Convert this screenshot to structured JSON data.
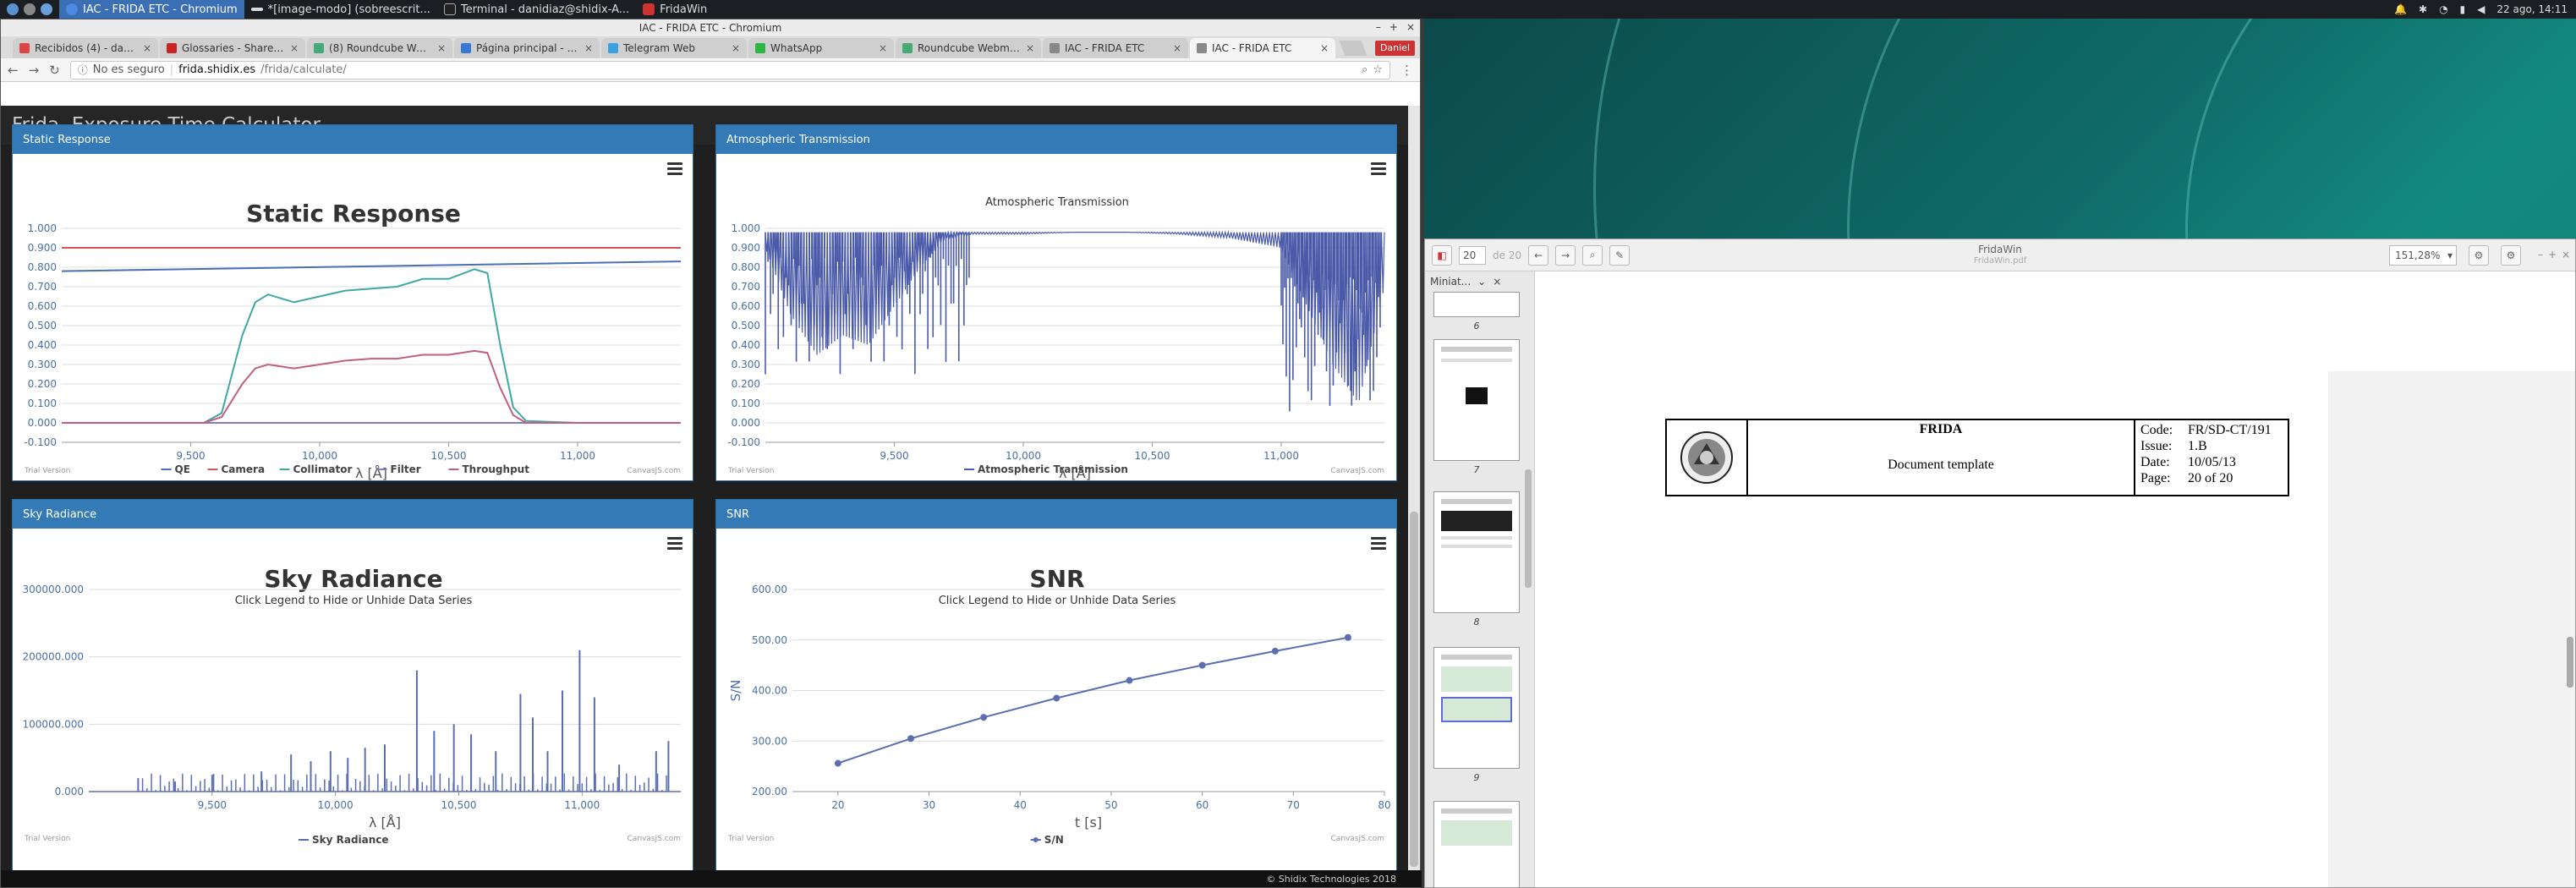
{
  "taskbar": {
    "items": [
      {
        "label": "IAC - FRIDA ETC - Chromium",
        "active": true
      },
      {
        "label": "*[image-modo] (sobreescrit...",
        "active": false
      },
      {
        "label": "Terminal - danidiaz@shidix-A...",
        "active": false
      },
      {
        "label": "FridaWin",
        "active": false
      }
    ],
    "clock": "22 ago, 14:11"
  },
  "browser": {
    "window_title": "IAC - FRIDA ETC - Chromium",
    "tabs": [
      {
        "label": "Recibidos (4) - danidi..."
      },
      {
        "label": "Glossaries - Shared..."
      },
      {
        "label": "(8) Roundcube Web..."
      },
      {
        "label": "Página principal - D..."
      },
      {
        "label": "Telegram Web"
      },
      {
        "label": "WhatsApp"
      },
      {
        "label": "Roundcube Webmail..."
      },
      {
        "label": "IAC - FRIDA ETC"
      },
      {
        "label": "IAC - FRIDA ETC"
      }
    ],
    "active_tab_index": 8,
    "user_chip": "Daniel",
    "security": "No es seguro",
    "url_host": "frida.shidix.es",
    "url_path": "/frida/calculate/"
  },
  "page": {
    "header": "Frida. Exposure Time Calculator",
    "footer": "© Shidix Technologies 2018",
    "trial_text": "Trial Version",
    "watermark": "CanvasJS.com"
  },
  "panels": {
    "static": {
      "head": "Static Response",
      "title": "Static Response",
      "xlabel": "λ [Å]"
    },
    "atmos": {
      "head": "Atmospheric Transmission",
      "title": "Atmospheric Transmission",
      "xlabel": "λ [Å]"
    },
    "sky": {
      "head": "Sky Radiance",
      "title": "Sky Radiance",
      "subtitle": "Click Legend to Hide or Unhide Data Series",
      "xlabel": "λ [Å]"
    },
    "snr": {
      "head": "SNR",
      "title": "SNR",
      "subtitle": "Click Legend to Hide or Unhide Data Series",
      "xlabel": "t [s]",
      "ylabel": "S/N"
    }
  },
  "chart_data": [
    {
      "type": "line",
      "title": "Static Response",
      "xlabel": "λ [Å]",
      "ylabel": "",
      "xlim": [
        9000,
        11400
      ],
      "ylim": [
        -0.1,
        1.0
      ],
      "x_ticks": [
        "9,500",
        "10,000",
        "10,500",
        "11,000"
      ],
      "y_ticks": [
        "-0.100",
        "0.000",
        "0.100",
        "0.200",
        "0.300",
        "0.400",
        "0.500",
        "0.600",
        "0.700",
        "0.800",
        "0.900",
        "1.000"
      ],
      "series": [
        {
          "name": "QE",
          "color": "#4a6fb5",
          "x": [
            9000,
            11400
          ],
          "values": [
            0.78,
            0.83
          ]
        },
        {
          "name": "Camera",
          "color": "#cf5656",
          "x": [
            9000,
            11400
          ],
          "values": [
            0.9,
            0.9
          ]
        },
        {
          "name": "Collimator",
          "color": "#3fa8a0",
          "x": [
            9000,
            9550,
            9620,
            9700,
            9750,
            9800,
            9900,
            10000,
            10100,
            10300,
            10400,
            10500,
            10600,
            10650,
            10700,
            10750,
            10800,
            11000,
            11400
          ],
          "values": [
            0.0,
            0.0,
            0.05,
            0.45,
            0.62,
            0.66,
            0.62,
            0.65,
            0.68,
            0.7,
            0.74,
            0.74,
            0.79,
            0.77,
            0.4,
            0.08,
            0.01,
            0.0,
            0.0
          ]
        },
        {
          "name": "Filter",
          "color": "#8c7ab8",
          "x": [
            9000,
            11400
          ],
          "values": [
            0.0,
            0.0
          ]
        },
        {
          "name": "Throughput",
          "color": "#c06080",
          "x": [
            9000,
            9550,
            9620,
            9700,
            9750,
            9800,
            9900,
            10000,
            10100,
            10200,
            10300,
            10400,
            10500,
            10600,
            10650,
            10700,
            10750,
            10800,
            11000,
            11400
          ],
          "values": [
            0.0,
            0.0,
            0.03,
            0.2,
            0.28,
            0.3,
            0.28,
            0.3,
            0.32,
            0.33,
            0.33,
            0.35,
            0.35,
            0.37,
            0.36,
            0.18,
            0.04,
            0.0,
            0.0,
            0.0
          ]
        }
      ],
      "legend_placement": "bottom"
    },
    {
      "type": "line",
      "title": "Atmospheric Transmission",
      "xlabel": "λ [Å]",
      "xlim": [
        9000,
        11400
      ],
      "ylim": [
        -0.1,
        1.0
      ],
      "x_ticks": [
        "9,500",
        "10,000",
        "10,500",
        "11,000"
      ],
      "y_ticks": [
        "-0.100",
        "0.000",
        "0.100",
        "0.200",
        "0.300",
        "0.400",
        "0.500",
        "0.600",
        "0.700",
        "0.800",
        "0.900",
        "1.000"
      ],
      "series": [
        {
          "name": "Atmospheric Transmission",
          "color": "#4a5aa8",
          "x": [
            9000,
            9100,
            9200,
            9300,
            9400,
            9500,
            9600,
            9700,
            9800,
            10000,
            10200,
            10400,
            10600,
            10800,
            11000,
            11100,
            11200,
            11300,
            11400
          ],
          "values": [
            0.9,
            0.55,
            0.35,
            0.45,
            0.4,
            0.6,
            0.8,
            0.95,
            0.97,
            0.97,
            0.98,
            0.98,
            0.97,
            0.95,
            0.9,
            0.6,
            0.3,
            0.1,
            0.7
          ]
        }
      ],
      "legend_placement": "bottom"
    },
    {
      "type": "line",
      "title": "Sky Radiance",
      "subtitle": "Click Legend to Hide or Unhide Data Series",
      "xlabel": "λ [Å]",
      "xlim": [
        9000,
        11400
      ],
      "ylim": [
        0,
        300000
      ],
      "x_ticks": [
        "9,500",
        "10,000",
        "10,500",
        "11,000"
      ],
      "y_ticks": [
        "0.000",
        "100000.000",
        "200000.000",
        "300000.000"
      ],
      "series": [
        {
          "name": "Sky Radiance",
          "color": "#5b6fb0",
          "x": [
            9200,
            9350,
            9500,
            9700,
            9820,
            9900,
            9980,
            10050,
            10120,
            10200,
            10330,
            10400,
            10480,
            10550,
            10650,
            10750,
            10800,
            10860,
            10920,
            10990,
            11050,
            11150,
            11300,
            11350
          ],
          "values": [
            20000,
            15000,
            25000,
            30000,
            55000,
            45000,
            60000,
            50000,
            65000,
            70000,
            180000,
            90000,
            100000,
            85000,
            60000,
            145000,
            110000,
            60000,
            150000,
            210000,
            140000,
            40000,
            60000,
            75000
          ]
        }
      ],
      "legend_placement": "bottom"
    },
    {
      "type": "line",
      "title": "SNR",
      "subtitle": "Click Legend to Hide or Unhide Data Series",
      "xlabel": "t [s]",
      "ylabel": "S/N",
      "xlim": [
        15,
        80
      ],
      "ylim": [
        200,
        600
      ],
      "x_ticks": [
        "20",
        "30",
        "40",
        "50",
        "60",
        "70",
        "80"
      ],
      "y_ticks": [
        "200.00",
        "300.00",
        "400.00",
        "500.00",
        "600.00"
      ],
      "series": [
        {
          "name": "S/N",
          "color": "#5b6fb0",
          "x": [
            20,
            28,
            36,
            44,
            52,
            60,
            68,
            76
          ],
          "values": [
            256,
            305,
            347,
            385,
            420,
            450,
            478,
            505
          ]
        }
      ],
      "legend_placement": "bottom"
    }
  ],
  "pdf": {
    "title": "FridaWin",
    "subtitle": "FridaWin.pdf",
    "page_input": "20",
    "page_total": "de 20",
    "zoom": "151,28%",
    "sidebar_label": "Miniat...",
    "thumb_pages": [
      "6",
      "7",
      "8",
      "9"
    ],
    "doc": {
      "name": "FRIDA",
      "subtitle": "Document template",
      "code_label": "Code:",
      "code": "FR/SD-CT/191",
      "issue_label": "Issue:",
      "issue": "1.B",
      "date_label": "Date:",
      "date": "10/05/13",
      "page_label": "Page:",
      "page": "20 of 20"
    }
  }
}
